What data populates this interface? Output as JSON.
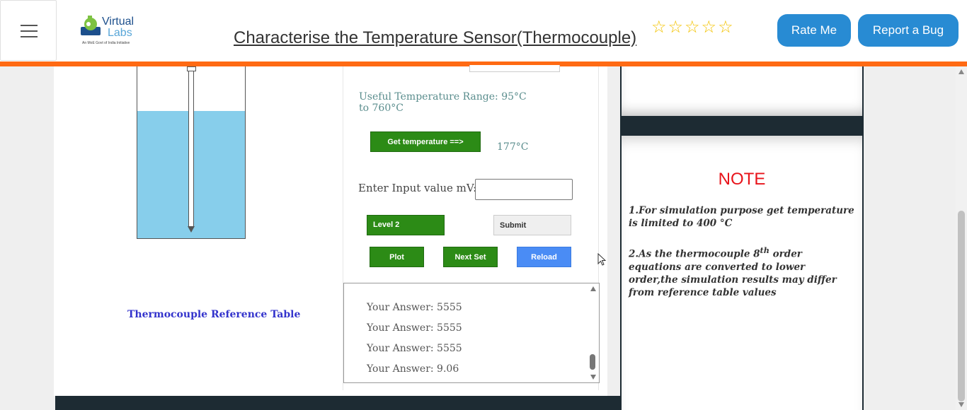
{
  "header": {
    "logo_title": "Virtual",
    "logo_title2": "Labs",
    "logo_subtitle": "An MoE Govt of India Initiative",
    "page_title": "Characterise the Temperature Sensor(Thermocouple)",
    "stars": "☆☆☆☆☆",
    "rate_label": "Rate Me",
    "bug_label": "Report a Bug",
    "accent_color": "#ff6a13"
  },
  "simulation": {
    "reference_table_link": "Thermocouple Reference Table",
    "temp_range": "Useful Temperature Range: 95°C to 760°C",
    "get_temp_label": "Get temperature ==>",
    "temperature_value": "177°C",
    "input_label": "Enter Input value mV:",
    "input_value": "",
    "level_label": "Level 2",
    "submit_label": "Submit",
    "plot_label": "Plot",
    "next_label": "Next Set",
    "reload_label": "Reload",
    "answers": [
      "Your Answer: 5555",
      "Your Answer: 5555",
      "Your Answer: 5555",
      "Your Answer: 9.06"
    ]
  },
  "note": {
    "title": "NOTE",
    "item1": "1.For simulation purpose get temperature is limited to 400 °C",
    "item2_prefix": "2.As the thermocouple 8",
    "item2_sup": "th",
    "item2_rest": " order equations are converted to lower order,the simulation results may differ from reference table values"
  }
}
